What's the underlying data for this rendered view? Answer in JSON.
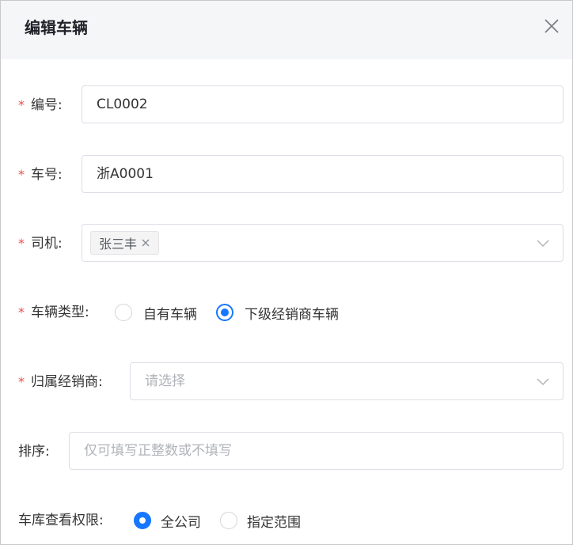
{
  "dialog": {
    "title": "编辑车辆",
    "close_icon": "close-icon"
  },
  "form": {
    "required_mark": "*",
    "code": {
      "label": "编号:",
      "value": "CL0002"
    },
    "plate": {
      "label": "车号:",
      "value": "浙A0001"
    },
    "driver": {
      "label": "司机:",
      "tags": [
        "张三丰"
      ],
      "dropdown_icon": "chevron-down-icon"
    },
    "vehicle_type": {
      "label": "车辆类型:",
      "options": [
        "自有车辆",
        "下级经销商车辆"
      ],
      "selected": "下级经销商车辆"
    },
    "dealer": {
      "label": "归属经销商:",
      "placeholder": "请选择",
      "dropdown_icon": "chevron-down-icon"
    },
    "sort": {
      "label": "排序:",
      "placeholder": "仅可填写正整数或不填写"
    },
    "garage_scope": {
      "label": "车库查看权限:",
      "options": [
        "全公司",
        "指定范围"
      ],
      "selected": "全公司"
    }
  },
  "colors": {
    "required": "#f04c4c",
    "accent": "#1677ff",
    "header_bg": "#f5f6f8"
  }
}
